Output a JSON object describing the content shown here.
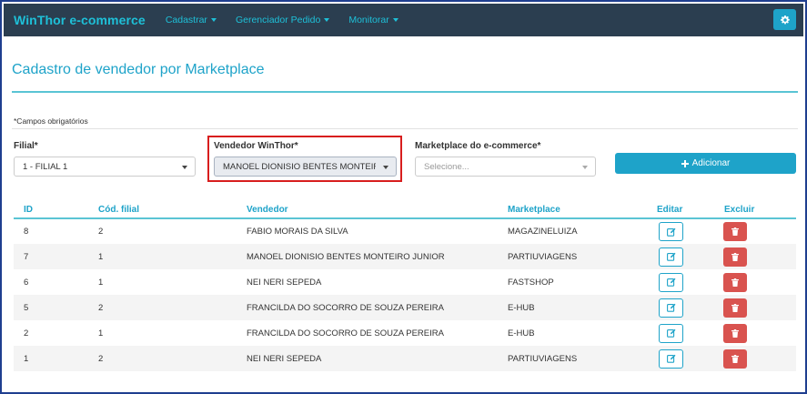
{
  "navbar": {
    "brand": "WinThor e-commerce",
    "menus": [
      {
        "label": "Cadastrar"
      },
      {
        "label": "Gerenciador Pedido"
      },
      {
        "label": "Monitorar"
      }
    ],
    "settings_icon": "gear-icon"
  },
  "page": {
    "title": "Cadastro de vendedor por Marketplace",
    "required_note": "*Campos obrigatórios"
  },
  "form": {
    "filial": {
      "label": "Filial*",
      "value": "1 - FILIAL 1"
    },
    "vendedor": {
      "label": "Vendedor WinThor*",
      "value": "MANOEL DIONISIO BENTES MONTEIRO JUNIOR"
    },
    "marketplace": {
      "label": "Marketplace do e-commerce*",
      "placeholder": "Selecione..."
    },
    "add_button": {
      "label": "Adicionar",
      "icon": "plus-icon"
    }
  },
  "table": {
    "headers": {
      "id": "ID",
      "filial": "Cód. filial",
      "vendedor": "Vendedor",
      "marketplace": "Marketplace",
      "editar": "Editar",
      "excluir": "Excluir"
    },
    "rows": [
      {
        "id": "8",
        "filial": "2",
        "vendedor": "FABIO MORAIS DA SILVA",
        "marketplace": "MAGAZINELUIZA"
      },
      {
        "id": "7",
        "filial": "1",
        "vendedor": "MANOEL DIONISIO BENTES MONTEIRO JUNIOR",
        "marketplace": "PARTIUVIAGENS"
      },
      {
        "id": "6",
        "filial": "1",
        "vendedor": "NEI NERI SEPEDA",
        "marketplace": "FASTSHOP"
      },
      {
        "id": "5",
        "filial": "2",
        "vendedor": "FRANCILDA DO SOCORRO DE SOUZA PEREIRA",
        "marketplace": "E-HUB"
      },
      {
        "id": "2",
        "filial": "1",
        "vendedor": "FRANCILDA DO SOCORRO DE SOUZA PEREIRA",
        "marketplace": "E-HUB"
      },
      {
        "id": "1",
        "filial": "2",
        "vendedor": "NEI NERI SEPEDA",
        "marketplace": "PARTIUVIAGENS"
      }
    ],
    "edit_icon": "edit-icon",
    "delete_icon": "trash-icon"
  },
  "colors": {
    "navbar_bg": "#2b3e50",
    "accent": "#1ea3c9",
    "danger": "#d9534f",
    "highlight": "#d81e1e"
  }
}
